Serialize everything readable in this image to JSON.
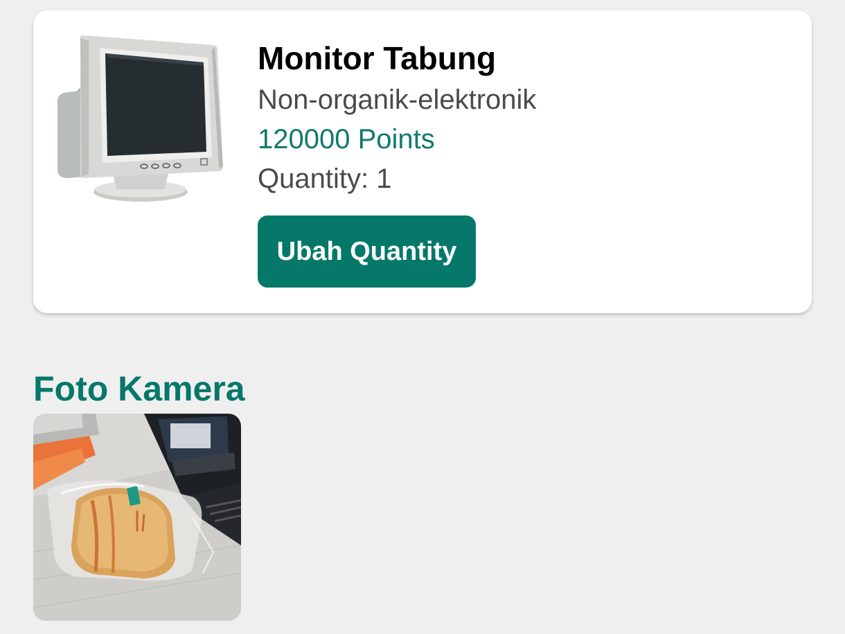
{
  "item": {
    "name": "Monitor Tabung",
    "category": "Non-organik-elektronik",
    "points": "120000 Points",
    "quantity": "Quantity: 1",
    "edit_button_label": "Ubah Quantity",
    "image_icon": "crt-monitor-image"
  },
  "camera_section": {
    "title": "Foto Kamera",
    "photo_icon": "camera-photo-bread-on-desk"
  },
  "colors": {
    "accent": "#05786a",
    "points_text": "#0f7a6c",
    "background": "#efefef",
    "card": "#ffffff"
  }
}
